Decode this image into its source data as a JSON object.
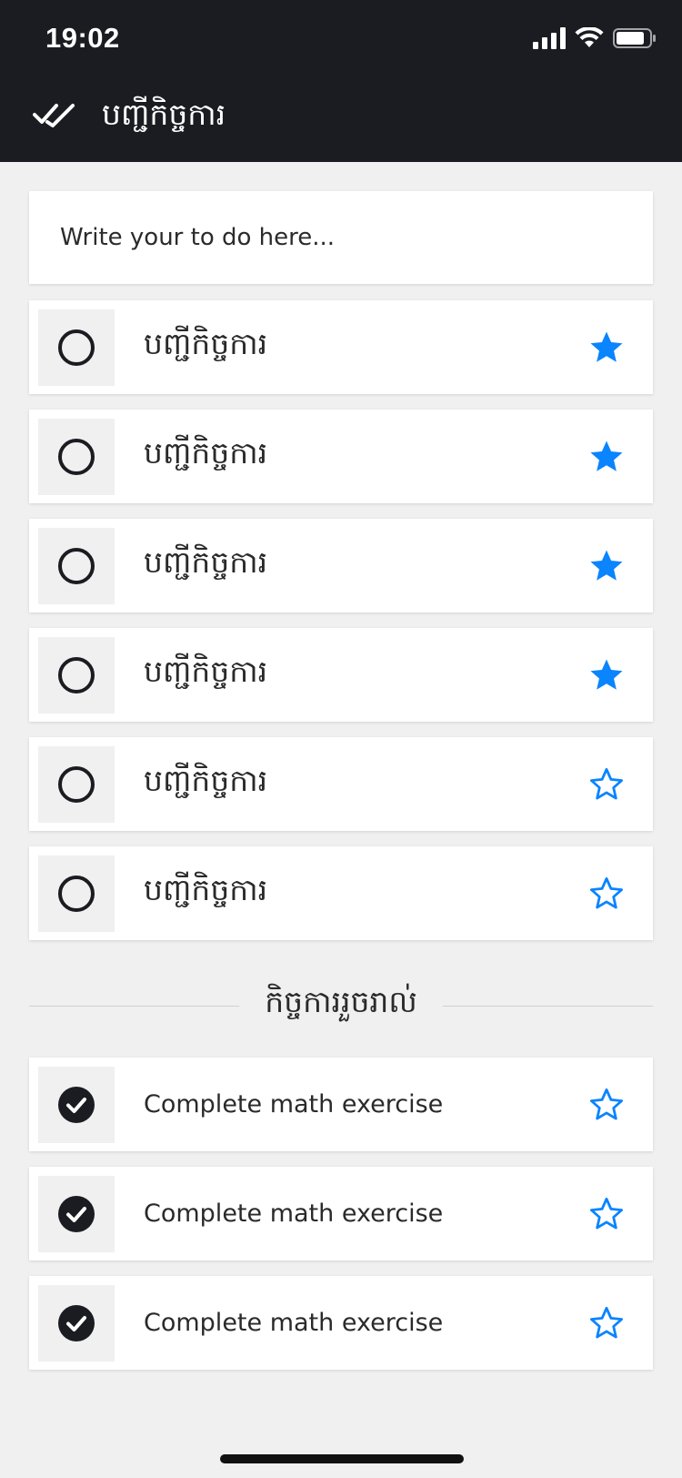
{
  "status_bar": {
    "time": "19:02"
  },
  "app_bar": {
    "title": "បញ្ជីកិច្ចការ",
    "icon": "double-check-icon"
  },
  "input": {
    "placeholder": "Write your to do here...",
    "value": ""
  },
  "pending": [
    {
      "label": "បញ្ជីកិច្ចការ",
      "starred": true
    },
    {
      "label": "បញ្ជីកិច្ចការ",
      "starred": true
    },
    {
      "label": "បញ្ជីកិច្ចការ",
      "starred": true
    },
    {
      "label": "បញ្ជីកិច្ចការ",
      "starred": true
    },
    {
      "label": "បញ្ជីកិច្ចការ",
      "starred": false
    },
    {
      "label": "បញ្ជីកិច្ចការ",
      "starred": false
    }
  ],
  "completed_section": {
    "title": "កិច្ចការរួចរាល់"
  },
  "completed": [
    {
      "label": "Complete math exercise",
      "starred": false
    },
    {
      "label": "Complete math exercise",
      "starred": false
    },
    {
      "label": "Complete math exercise",
      "starred": false
    }
  ],
  "colors": {
    "header_bg": "#1b1c21",
    "accent_star": "#0a84ff",
    "page_bg": "#f0f0f0"
  }
}
